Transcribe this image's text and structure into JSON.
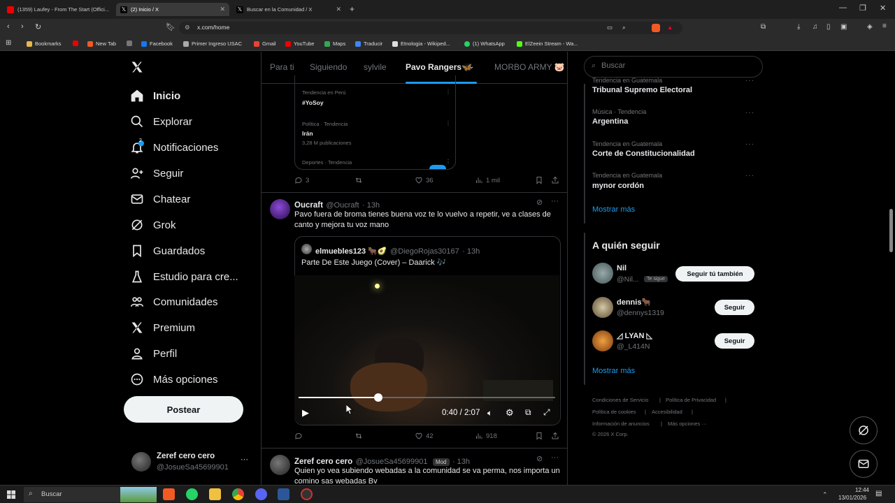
{
  "browser": {
    "tabs": [
      {
        "label": "(1359) Laufey - From The Start (Offici..."
      },
      {
        "label": "(2) Inicio / X"
      },
      {
        "label": "Buscar en la Comunidad / X"
      }
    ],
    "url": "x.com/home",
    "bookmarks": [
      "Bookmarks",
      "New Tab",
      "Facebook",
      "Primer Ingreso USAC",
      "Gmail",
      "YouTube",
      "Maps",
      "Traducir",
      "Etnologia - Wikiped...",
      "(1) WhatsApp",
      "ElZeein Stream - Wa..."
    ]
  },
  "nav": {
    "items": [
      "Inicio",
      "Explorar",
      "Notificaciones",
      "Seguir",
      "Chatear",
      "Grok",
      "Guardados",
      "Estudio para cre...",
      "Comunidades",
      "Premium",
      "Perfil",
      "Más opciones"
    ],
    "notif_badge": "2",
    "post_label": "Postear",
    "account": {
      "name": "Zeref cero cero",
      "handle": "@JosueSa45699901",
      "more": "···"
    }
  },
  "center_tabs": {
    "items": [
      "Para ti",
      "Siguiendo",
      "sylvile",
      "Pavo Rangers🦋",
      "MORBO ARMY 🐷"
    ]
  },
  "trends_embed": {
    "t1_cat": "Tendencia en Perú",
    "t1_name": "#YoSoy",
    "t2_cat": "Política · Tendencia",
    "t2_name": "Irán",
    "t2_count": "3,28 M publicaciones",
    "t3_cat": "Deportes · Tendencia"
  },
  "post1_actions": {
    "replies": "3",
    "likes": "36",
    "views": "1 mil"
  },
  "post2": {
    "name": "Oucraft",
    "handle": "@Oucraft",
    "time": "· 13h",
    "text": "Pavo fuera de broma tienes buena voz te lo vuelvo a repetir, ve a clases de canto y mejora tu voz mano",
    "quote": {
      "name": "elmuebles123 🐂🥑",
      "handle": "@DiegoRojas30167",
      "time": "· 13h",
      "text": "Parte De Este Juego (Cover) – Daarick 🎶"
    },
    "video": {
      "time": "0:40 / 2:07",
      "progress": 0.31
    },
    "actions": {
      "likes": "42",
      "views": "918"
    }
  },
  "post3": {
    "name": "Zeref cero cero",
    "handle": "@JosueSa45699901",
    "badge": "Mod",
    "time": "· 13h",
    "text": "Quien yo vea subiendo webadas a la comunidad se va perma, nos importa un comino sas webadas Bv"
  },
  "right": {
    "search_placeholder": "Buscar",
    "trends": [
      {
        "cat": "Tendencia en Guatemala",
        "name": "Tribunal Supremo Electoral"
      },
      {
        "cat": "Música · Tendencia",
        "name": "Argentina"
      },
      {
        "cat": "Tendencia en Guatemala",
        "name": "Corte de Constitucionalidad"
      },
      {
        "cat": "Tendencia en Guatemala",
        "name": "mynor cordón"
      }
    ],
    "show_more": "Mostrar más",
    "who_to_follow": "A quién seguir",
    "follows": [
      {
        "name": "Nil",
        "handle": "@Nil...",
        "tag": "Te sigue",
        "button": "Seguir tú también"
      },
      {
        "name": "dennis🐂",
        "handle": "@dennys1319",
        "button": "Seguir"
      },
      {
        "name": "◿ LYAN ◺",
        "handle": "@_L414N",
        "button": "Seguir"
      }
    ],
    "show_more2": "Mostrar más",
    "footer": [
      "Condiciones de Servicio",
      "|",
      "Política de Privacidad",
      "|",
      "Política de cookies",
      "|",
      "Accesibilidad",
      "|",
      "Información de anuncios",
      "|",
      "Más opciones ···",
      "© 2026 X Corp."
    ]
  },
  "taskbar": {
    "search": "Buscar",
    "time": "12:44",
    "date": "13/01/2026"
  },
  "colors": {
    "accent": "#1d9bf0",
    "bg": "#000000",
    "border": "#2f3336",
    "muted": "#71767b"
  }
}
